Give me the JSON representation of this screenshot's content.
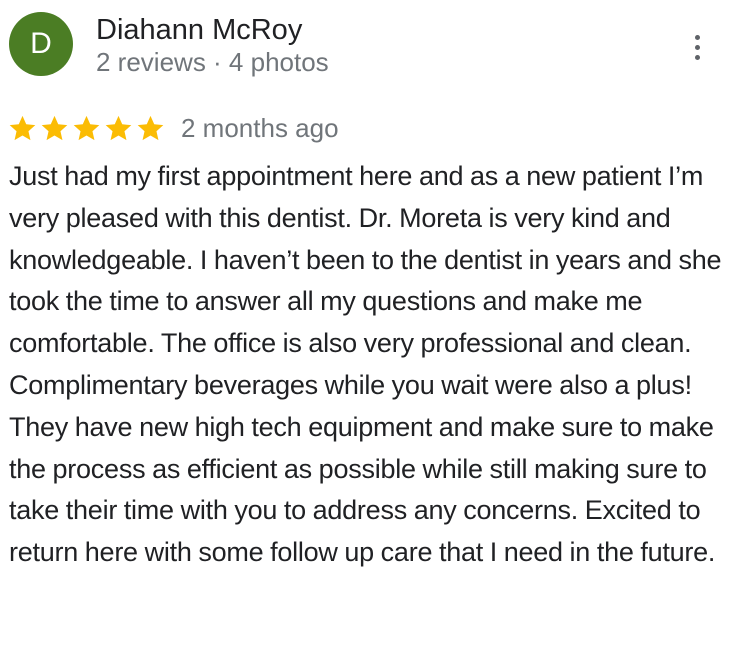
{
  "reviewer": {
    "avatar_letter": "D",
    "avatar_color": "#4b7d24",
    "name": "Diahann McRoy",
    "meta": "2 reviews · 4 photos"
  },
  "menu": {
    "icon": "more-vert-icon"
  },
  "review": {
    "rating": 5,
    "rating_max": 5,
    "star_color": "#fbbc04",
    "date": "2 months ago",
    "text": "Just had my first appointment here and as a new patient I’m very pleased with this dentist. Dr. Moreta is very kind and knowledgeable. I haven’t been to the dentist in years and she took the time to answer all my questions and make me comfortable. The office is also very professional and clean. Complimentary beverages while you wait were also a plus! They have new high tech equipment and make sure to make the process as efficient as possible while still making sure to take their time with you to address any concerns. Excited to return here with some follow up care that I need in the future."
  }
}
